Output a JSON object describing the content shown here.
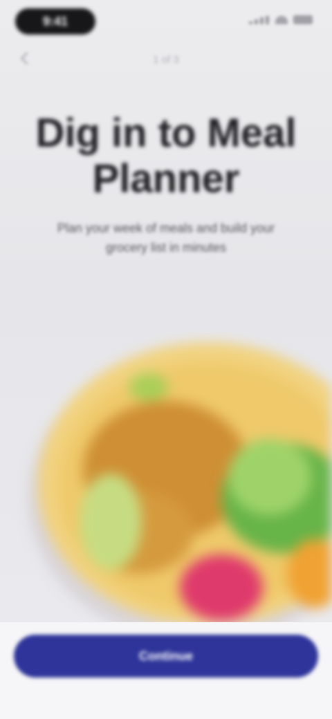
{
  "status_bar": {
    "time": "9:41",
    "icons": [
      "signal-icon",
      "wifi-icon",
      "battery-icon"
    ]
  },
  "nav": {
    "back_icon": "back-chevron-icon",
    "step": "1 of 3"
  },
  "hero": {
    "title": "Dig in to Meal Planner",
    "subtitle": "Plan your week of meals and build your grocery list in minutes"
  },
  "illustration": {
    "name": "food-bowl-illustration"
  },
  "cta": {
    "label": "Continue"
  },
  "colors": {
    "background": "#e9e9ed",
    "title_text": "#222226",
    "subtitle_text": "#55555c",
    "cta_background": "#2e3499",
    "cta_text": "#ffffff",
    "bowl_rim": "#f3d98a",
    "chickpeas": "#d89a3a",
    "radish": "#e2336a",
    "lime": "#b7d86a",
    "lettuce": "#3aa34a"
  }
}
